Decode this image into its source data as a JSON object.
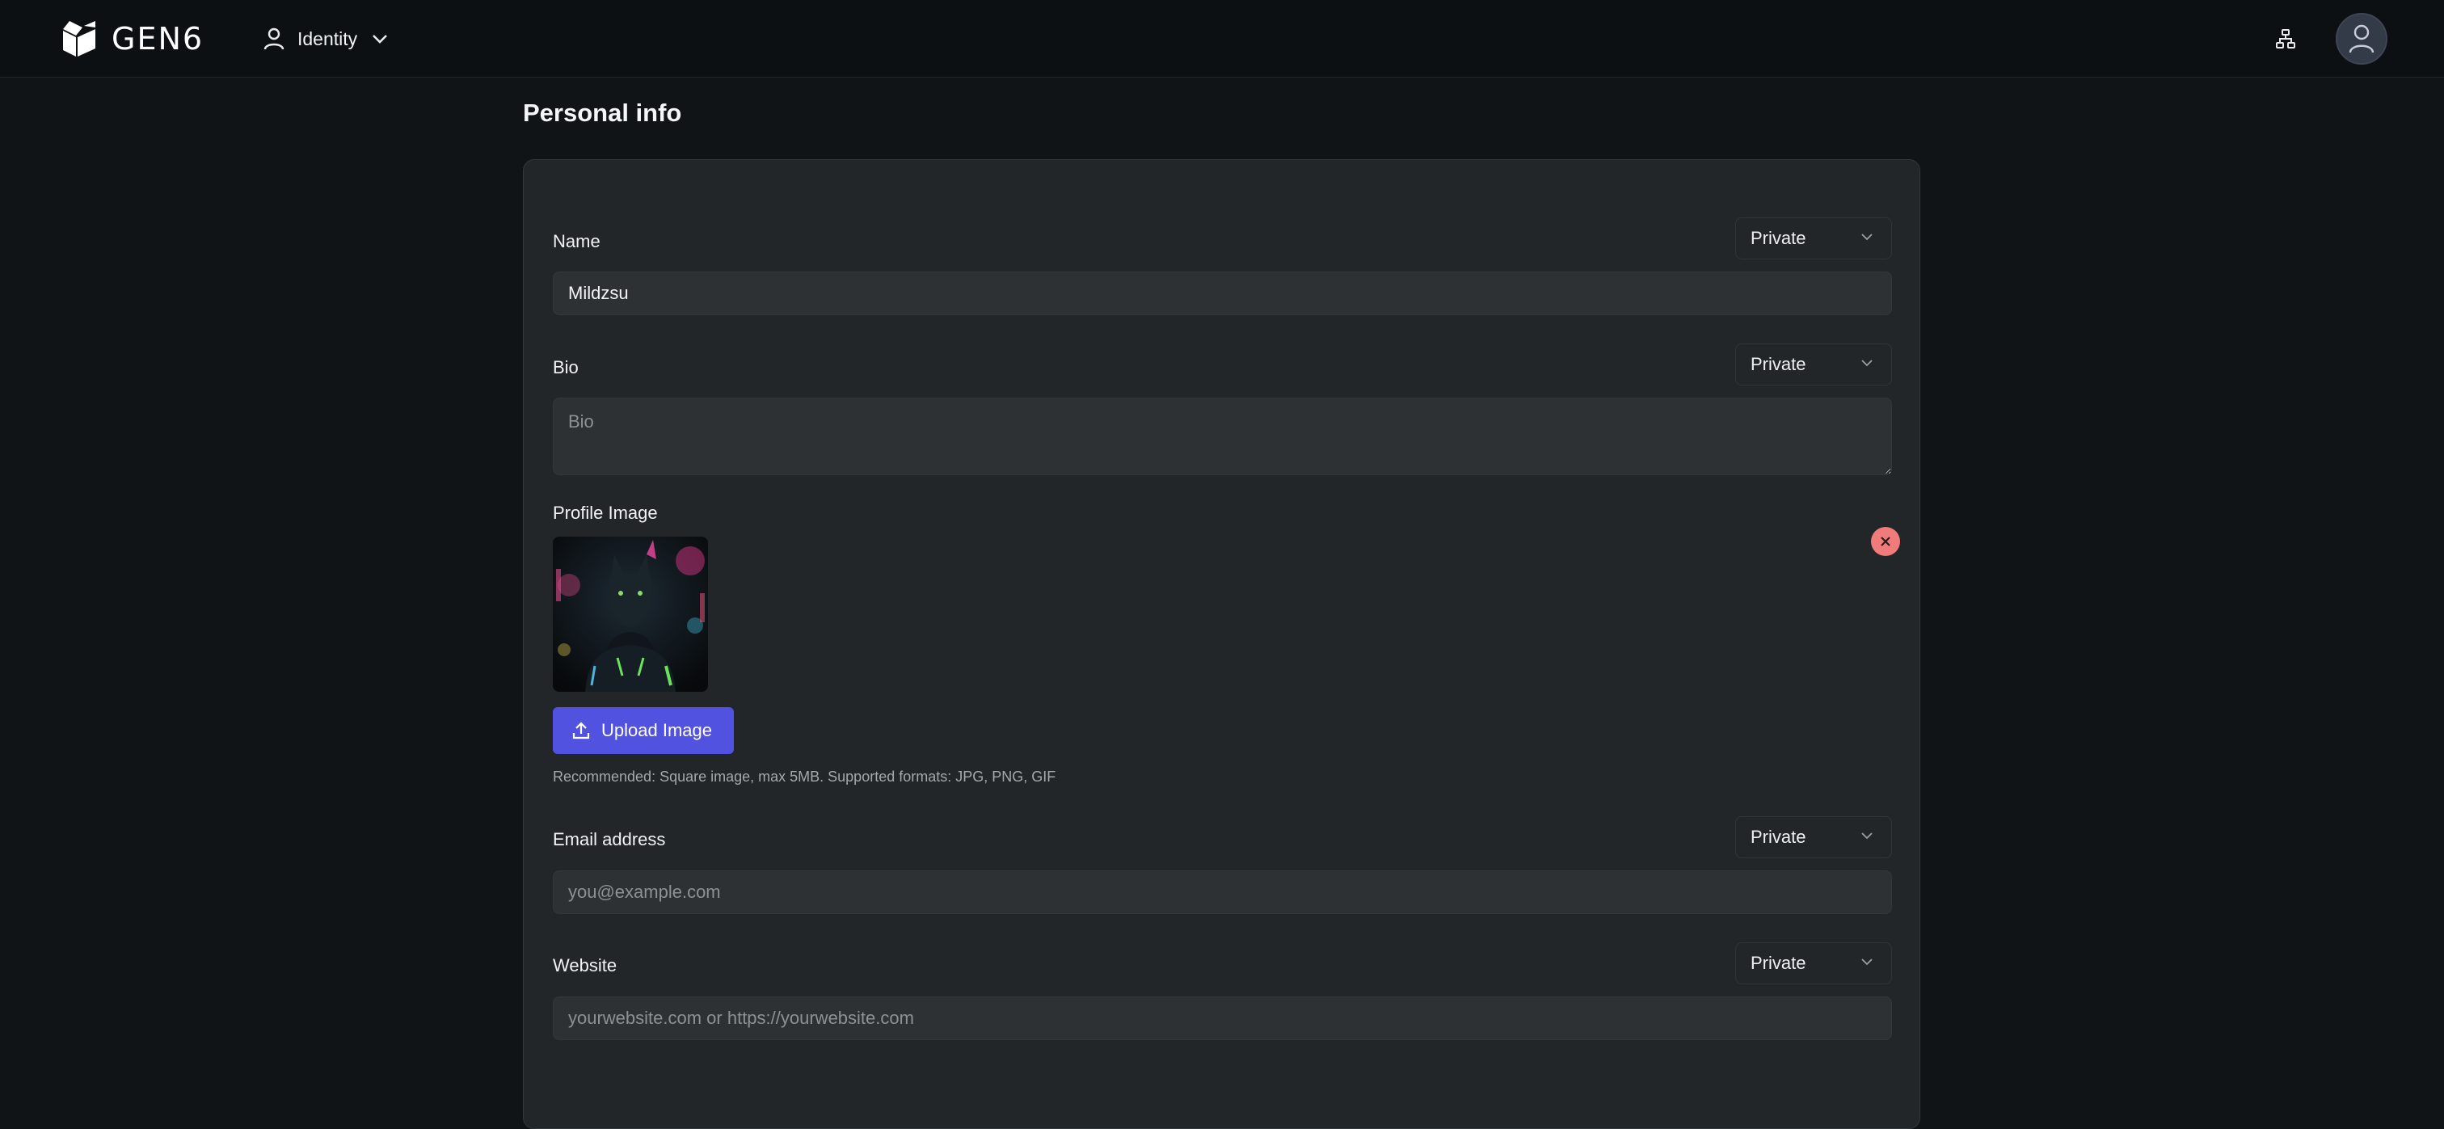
{
  "header": {
    "brand": "GEN6",
    "identity_label": "Identity"
  },
  "page": {
    "title": "Personal info"
  },
  "form": {
    "name": {
      "label": "Name",
      "privacy": "Private",
      "value": "Mildzsu"
    },
    "bio": {
      "label": "Bio",
      "privacy": "Private",
      "placeholder": "Bio"
    },
    "profile_image": {
      "label": "Profile Image",
      "upload_label": "Upload Image",
      "hint": "Recommended: Square image, max 5MB. Supported formats: JPG, PNG, GIF"
    },
    "email": {
      "label": "Email address",
      "privacy": "Private",
      "placeholder": "you@example.com"
    },
    "website": {
      "label": "Website",
      "privacy": "Private",
      "placeholder": "yourwebsite.com or https://yourwebsite.com"
    }
  },
  "icons": {
    "logo": "gen6-cube-logo",
    "identity": "user-icon",
    "identity_chevron": "chevron-down-icon",
    "network": "sitemap-icon",
    "avatar": "user-icon",
    "privacy_chevron": "chevron-down-icon",
    "remove": "close-icon",
    "upload": "upload-icon"
  },
  "colors": {
    "accent": "#5252e0",
    "danger": "#f07b7b",
    "background": "#111417",
    "card": "#232629"
  }
}
